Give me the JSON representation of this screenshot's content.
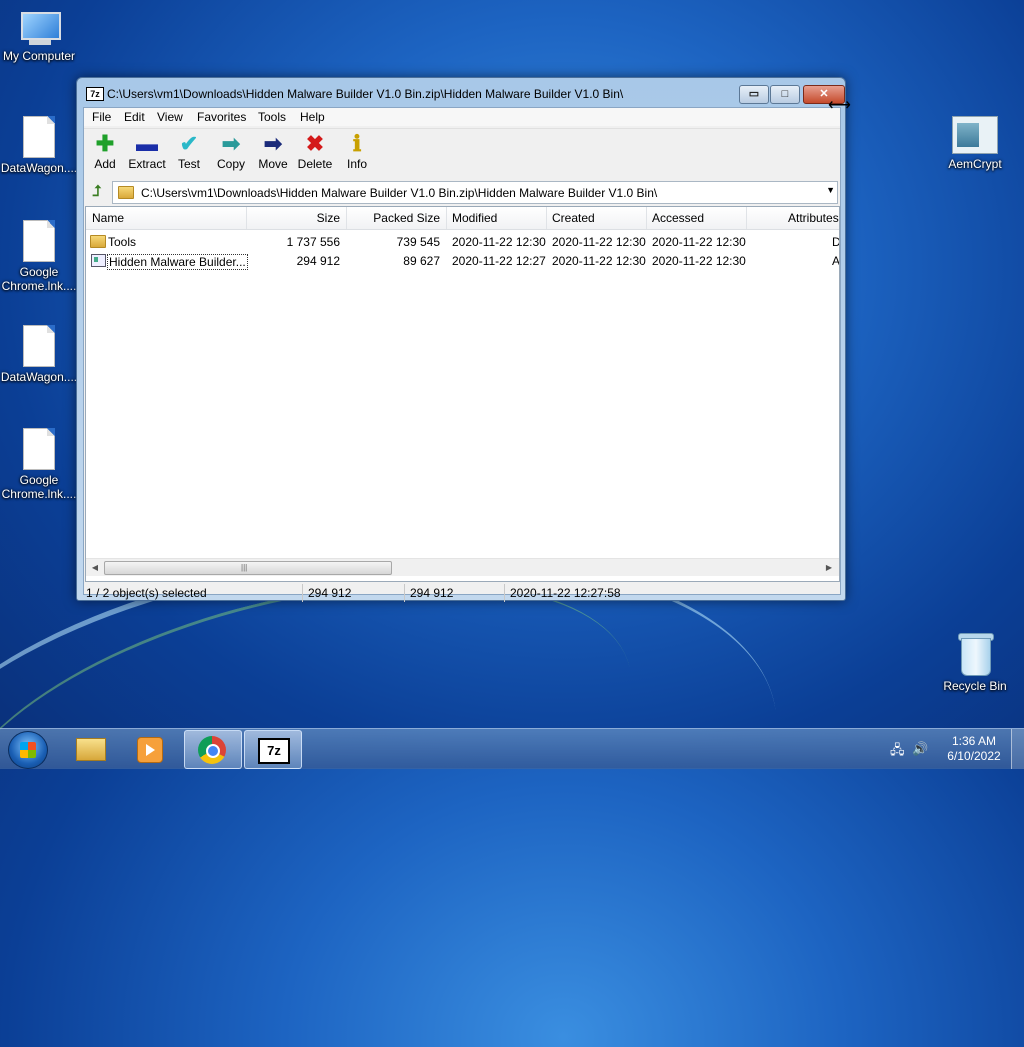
{
  "desktop": {
    "icons": [
      {
        "label": "My Computer"
      },
      {
        "label": "DataWagon...."
      },
      {
        "label": "Google Chrome.lnk...."
      },
      {
        "label": "DataWagon...."
      },
      {
        "label": "Google Chrome.lnk...."
      },
      {
        "label": "AemCrypt"
      },
      {
        "label": "Recycle Bin"
      }
    ]
  },
  "window": {
    "title": "C:\\Users\\vm1\\Downloads\\Hidden Malware Builder V1.0 Bin.zip\\Hidden Malware Builder V1.0 Bin\\",
    "app_icon_text": "7z",
    "controls": {
      "minimize": "▭",
      "maximize": "□",
      "close": "✕"
    },
    "menu": [
      "File",
      "Edit",
      "View",
      "Favorites",
      "Tools",
      "Help"
    ],
    "toolbar": [
      {
        "label": "Add",
        "icon": "plus-icon",
        "glyph": "✚",
        "color": "#1fa02a"
      },
      {
        "label": "Extract",
        "icon": "minus-icon",
        "glyph": "▬",
        "color": "#1a2ea8"
      },
      {
        "label": "Test",
        "icon": "check-icon",
        "glyph": "✔",
        "color": "#2ab8c8"
      },
      {
        "label": "Copy",
        "icon": "copy-arrow-icon",
        "glyph": "➡",
        "color": "#2a9a9a"
      },
      {
        "label": "Move",
        "icon": "move-arrow-icon",
        "glyph": "➡",
        "color": "#1a2a7a"
      },
      {
        "label": "Delete",
        "icon": "delete-x-icon",
        "glyph": "✖",
        "color": "#d41a1a"
      },
      {
        "label": "Info",
        "icon": "info-icon",
        "glyph": "ℹ",
        "color": "#c8a000"
      }
    ],
    "address": {
      "path": "C:\\Users\\vm1\\Downloads\\Hidden Malware Builder V1.0 Bin.zip\\Hidden Malware Builder V1.0 Bin\\",
      "dropdown": "▼",
      "up_glyph": "⮥"
    },
    "columns": [
      "Name",
      "Size",
      "Packed Size",
      "Modified",
      "Created",
      "Accessed",
      "Attributes"
    ],
    "rows": [
      {
        "name": "Tools",
        "size": "1 737 556",
        "packed": "739 545",
        "modified": "2020-11-22 12:30",
        "created": "2020-11-22 12:30",
        "accessed": "2020-11-22 12:30",
        "attributes": "D",
        "type": "folder"
      },
      {
        "name": "Hidden Malware Builder...",
        "size": "294 912",
        "packed": "89 627",
        "modified": "2020-11-22 12:27",
        "created": "2020-11-22 12:30",
        "accessed": "2020-11-22 12:30",
        "attributes": "A",
        "type": "file"
      }
    ],
    "scroll": {
      "left": "◀",
      "right": "▶",
      "grip": "|||"
    },
    "status": {
      "selected": "1 / 2 object(s) selected",
      "size": "294 912",
      "packed": "294 912",
      "modified": "2020-11-22 12:27:58"
    }
  },
  "taskbar": {
    "tray": {
      "network": "🖧",
      "volume": "🔊"
    },
    "clock": {
      "time": "1:36 AM",
      "date": "6/10/2022"
    }
  }
}
